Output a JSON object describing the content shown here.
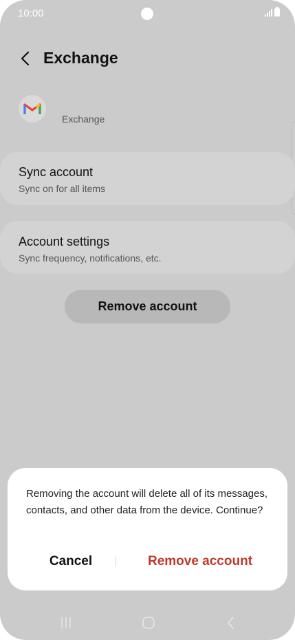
{
  "status_bar": {
    "time": "10:00"
  },
  "header": {
    "title": "Exchange"
  },
  "account": {
    "name": "Exchange"
  },
  "cards": [
    {
      "title": "Sync account",
      "subtitle": "Sync on for all items"
    },
    {
      "title": "Account settings",
      "subtitle": "Sync frequency, notifications, etc."
    }
  ],
  "remove_button": {
    "label": "Remove account"
  },
  "dialog": {
    "message": "Removing the account will delete all of its messages, contacts, and other data from the device. Continue?",
    "cancel_label": "Cancel",
    "confirm_label": "Remove account"
  },
  "colors": {
    "dim_background": "#cbcbcb",
    "destructive": "#c0392b",
    "dialog_background": "#ffffff"
  },
  "icons": {
    "back": "chevron-left-icon",
    "account_logo": "gmail-icon",
    "nav_recents": "recents-icon",
    "nav_home": "home-icon",
    "nav_back": "back-nav-icon"
  }
}
